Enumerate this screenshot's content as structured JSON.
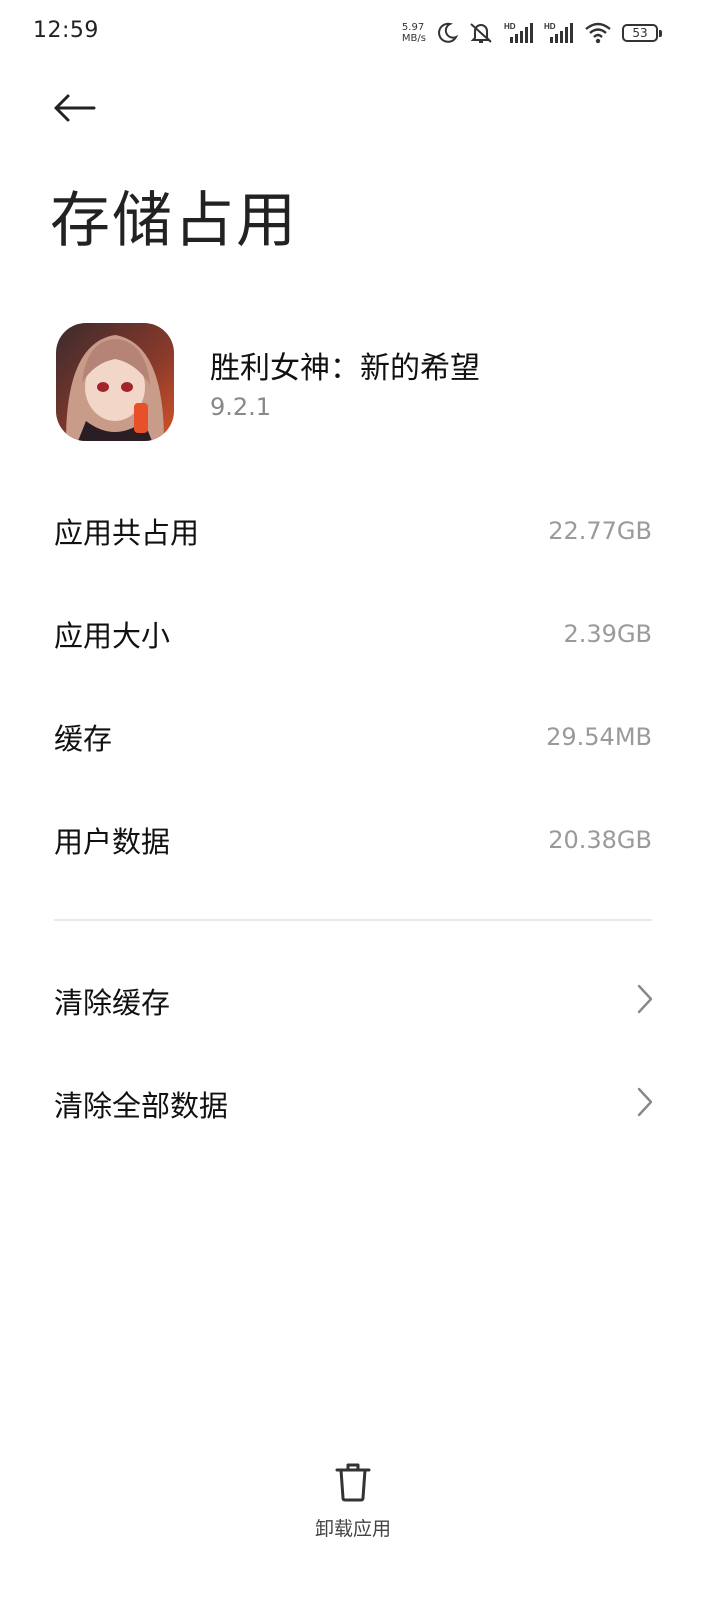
{
  "status_bar": {
    "time": "12:59",
    "net_speed_value": "5.97",
    "net_speed_unit": "MB/s",
    "battery": "53",
    "icons": [
      "moon-icon",
      "mute-bell-icon",
      "hd-signal-icon",
      "hd-signal-icon",
      "wifi-icon",
      "battery-icon"
    ]
  },
  "header": {
    "back_icon": "back-arrow-icon",
    "title": "存储占用"
  },
  "app": {
    "name": "胜利女神：新的希望",
    "version": "9.2.1"
  },
  "storage": {
    "rows": [
      {
        "label": "应用共占用",
        "value": "22.77GB"
      },
      {
        "label": "应用大小",
        "value": "2.39GB"
      },
      {
        "label": "缓存",
        "value": "29.54MB"
      },
      {
        "label": "用户数据",
        "value": "20.38GB"
      }
    ]
  },
  "actions": [
    {
      "label": "清除缓存"
    },
    {
      "label": "清除全部数据"
    }
  ],
  "bottom": {
    "uninstall_label": "卸载应用"
  },
  "colors": {
    "background": "#ffffff",
    "text_primary": "#111111",
    "text_secondary": "#9a9a9a",
    "divider": "#e9e9e9"
  }
}
